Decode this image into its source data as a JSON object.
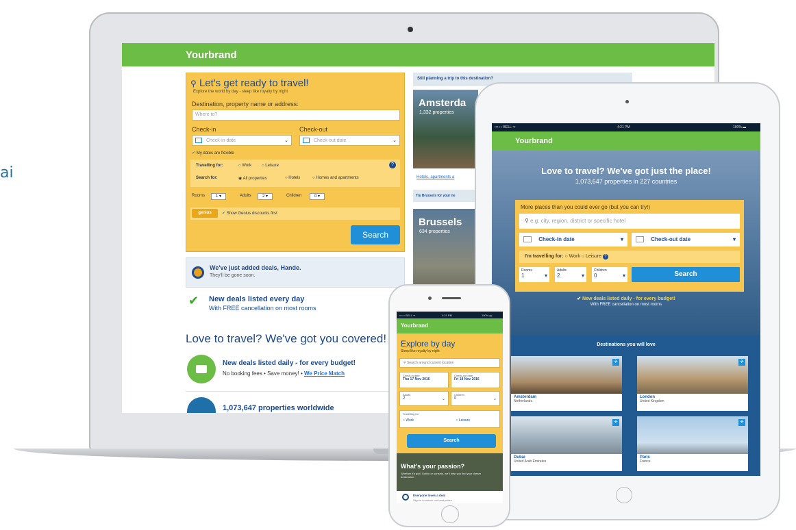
{
  "edge_text": "ai",
  "laptop": {
    "brand": "Yourbrand",
    "search": {
      "title": "Let's get ready to travel!",
      "subtitle": "Explore the world by day - sleep like royalty by night",
      "dest_label": "Destination, property name or address:",
      "dest_placeholder": "Where to?",
      "checkin_label": "Check-in",
      "checkout_label": "Check-out",
      "checkin_placeholder": "Check-in date",
      "checkout_placeholder": "Check-out date",
      "flexible": "My dates are flexible",
      "travelling_label": "Travelling for:",
      "work": "Work",
      "leisure": "Leisure",
      "search_for_label": "Search for:",
      "opt_all": "All properties",
      "opt_hotels": "Hotels",
      "opt_homes": "Homes and apartments",
      "rooms_label": "Rooms",
      "rooms_val": "1",
      "adults_label": "Adults",
      "adults_val": "2",
      "children_label": "Children",
      "children_val": "0",
      "genius_badge": "genius",
      "genius_text": "Show Genius discounts first",
      "button": "Search"
    },
    "deals": {
      "title": "We've just added deals, Hande.",
      "sub": "They'll be gone soon."
    },
    "new_deals": {
      "title": "New deals listed every day",
      "sub": "With FREE cancellation on most rooms"
    },
    "love_title": "Love to travel? We've got you covered!",
    "feature1": {
      "title": "New deals listed daily - for every budget!",
      "sub": "No booking fees • Save money! •",
      "link": "We Price Match"
    },
    "feature2_title": "1,073,647 properties worldwide",
    "side": {
      "header": "Still planning a trip to this destination?",
      "city1": "Amsterda",
      "city1_sub": "1,332 properties",
      "link1": "Hotels, apartments a",
      "try": "Try Brussels for your ne",
      "city2": "Brussels",
      "city2_sub": "634 properties"
    }
  },
  "tablet": {
    "status_left": "•••○○ BELL ᯤ",
    "status_time": "4:21 PM",
    "status_right": "100% ▬",
    "brand": "Yourbrand",
    "hero_title": "Love to travel? We've got just the place!",
    "hero_sub": "1,073,647 properties in 227 countries",
    "form_title": "More places than you could ever go (but you can try!)",
    "search_placeholder": "e.g. city, region, district or specific hotel",
    "checkin": "Check-in date",
    "checkout": "Check-out date",
    "travelling_label": "I'm travelling for:",
    "work": "Work",
    "leisure": "Leisure",
    "rooms_label": "Rooms",
    "rooms_val": "1",
    "adults_label": "Adults",
    "adults_val": "2",
    "children_label": "Children",
    "children_val": "0",
    "button": "Search",
    "deals_title": "New deals listed daily - for every budget!",
    "deals_sub": "With FREE cancellation on most rooms",
    "dest_title": "Destinations you will love",
    "dests": [
      {
        "name": "Amsterdam",
        "country": "Netherlands"
      },
      {
        "name": "London",
        "country": "United Kingdom"
      },
      {
        "name": "Dubai",
        "country": "United Arab Emirates"
      },
      {
        "name": "Paris",
        "country": "France"
      }
    ]
  },
  "phone": {
    "status_left": "•••○○ BELL ᯤ",
    "status_time": "4:21 PM",
    "status_right": "100% ▬",
    "brand": "Yourbrand",
    "title": "Explore by day",
    "subtitle": "Sleep like royalty by night",
    "search_placeholder": "Search around current location",
    "checkin_label": "Check-in date",
    "checkin_val": "Thu 17 Nov 2016",
    "checkout_label": "Check-out date",
    "checkout_val": "Fri 18 Nov 2016",
    "adults_label": "Adults",
    "adults_val": "2",
    "children_label": "Children",
    "children_val": "0",
    "travelling_label": "Travelling for",
    "work": "Work",
    "leisure": "Leisure",
    "button": "Search",
    "passion_title": "What's your passion?",
    "passion_sub": "Whether it's golf, Gothic or sunsets, we'll help you find your dream destination",
    "deal_title": "Everyone loves a deal",
    "deal_sub": "Sign in to unlock our best prices"
  }
}
